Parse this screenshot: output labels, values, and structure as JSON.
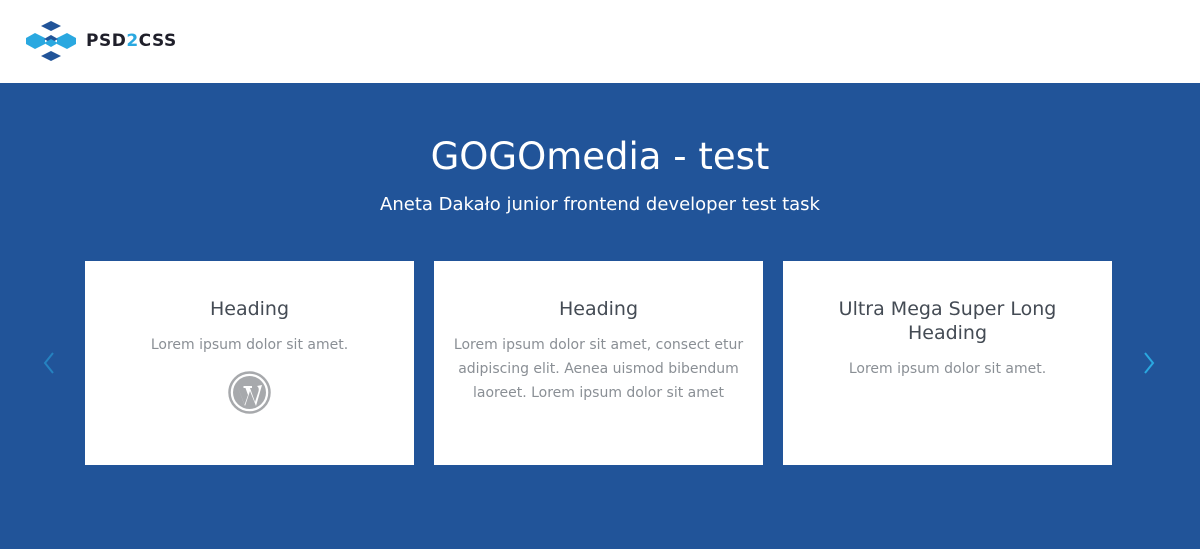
{
  "header": {
    "logo_text_left": "PSD",
    "logo_text_accent": "2",
    "logo_text_right": "CSS",
    "logo_icon": "psd2css-cube-logo"
  },
  "hero": {
    "title": "GOGOmedia - test",
    "subtitle": "Aneta Dakało junior frontend developer test task"
  },
  "carousel": {
    "prev_icon": "chevron-left-icon",
    "next_icon": "chevron-right-icon",
    "cards": [
      {
        "heading": "Heading",
        "text": "Lorem ipsum dolor sit amet.",
        "icon": "wordpress-icon"
      },
      {
        "heading": "Heading",
        "text": "Lorem ipsum dolor sit amet, consect etur adipiscing elit. Aenea uismod bibendum laoreet. Lorem ipsum dolor sit amet"
      },
      {
        "heading": "Ultra Mega Super Long Heading",
        "text": "Lorem ipsum dolor sit amet."
      }
    ]
  },
  "colors": {
    "hero_background": "#215499",
    "logo_accent": "#2aa8e0",
    "arrow": "#2aa8e0",
    "card_background": "#ffffff",
    "heading_text": "#444b54",
    "body_text": "#8a8f95",
    "icon_gray": "#a7a9ac"
  }
}
